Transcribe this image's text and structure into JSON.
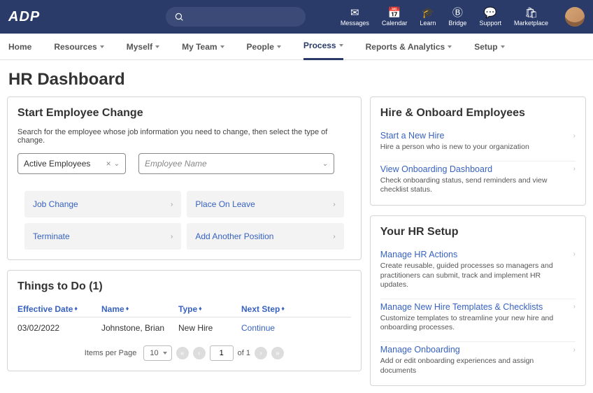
{
  "brand": "ADP",
  "top_icons": [
    {
      "name": "messages",
      "label": "Messages",
      "glyph": "✉"
    },
    {
      "name": "calendar",
      "label": "Calendar",
      "glyph": "📅"
    },
    {
      "name": "learn",
      "label": "Learn",
      "glyph": "🎓"
    },
    {
      "name": "bridge",
      "label": "Bridge",
      "glyph": "Ⓑ"
    },
    {
      "name": "support",
      "label": "Support",
      "glyph": "💬"
    },
    {
      "name": "marketplace",
      "label": "Marketplace",
      "glyph": "🛍"
    }
  ],
  "nav": {
    "home": "Home",
    "resources": "Resources",
    "myself": "Myself",
    "myteam": "My Team",
    "people": "People",
    "process": "Process",
    "reports": "Reports & Analytics",
    "setup": "Setup",
    "active": "process"
  },
  "page_title": "HR Dashboard",
  "start_change": {
    "title": "Start Employee Change",
    "helper": "Search for the employee whose job information you need to change, then select the type of change.",
    "filter_value": "Active Employees",
    "name_placeholder": "Employee Name",
    "actions": {
      "job_change": "Job Change",
      "place_on_leave": "Place On Leave",
      "terminate": "Terminate",
      "add_position": "Add Another Position"
    }
  },
  "things": {
    "title": "Things to Do (1)",
    "headers": {
      "date": "Effective Date",
      "name": "Name",
      "type": "Type",
      "step": "Next Step"
    },
    "rows": [
      {
        "date": "03/02/2022",
        "name": "Johnstone, Brian",
        "type": "New Hire",
        "step": "Continue"
      }
    ],
    "pager": {
      "ipp_label": "Items per Page",
      "ipp_value": "10",
      "page": "1",
      "of_label": "of 1"
    }
  },
  "hire_onboard": {
    "title": "Hire & Onboard Employees",
    "items": [
      {
        "link": "Start a New Hire",
        "desc": "Hire a person who is new to your organization"
      },
      {
        "link": "View Onboarding Dashboard",
        "desc": "Check onboarding status, send reminders and view checklist status."
      }
    ]
  },
  "hr_setup": {
    "title": "Your HR Setup",
    "items": [
      {
        "link": "Manage HR Actions",
        "desc": "Create reusable, guided processes so managers and practitioners can submit, track and implement HR updates."
      },
      {
        "link": "Manage New Hire Templates & Checklists",
        "desc": "Customize templates to streamline your new hire and onboarding processes."
      },
      {
        "link": "Manage Onboarding",
        "desc": "Add or edit onboarding experiences and assign documents"
      }
    ]
  }
}
